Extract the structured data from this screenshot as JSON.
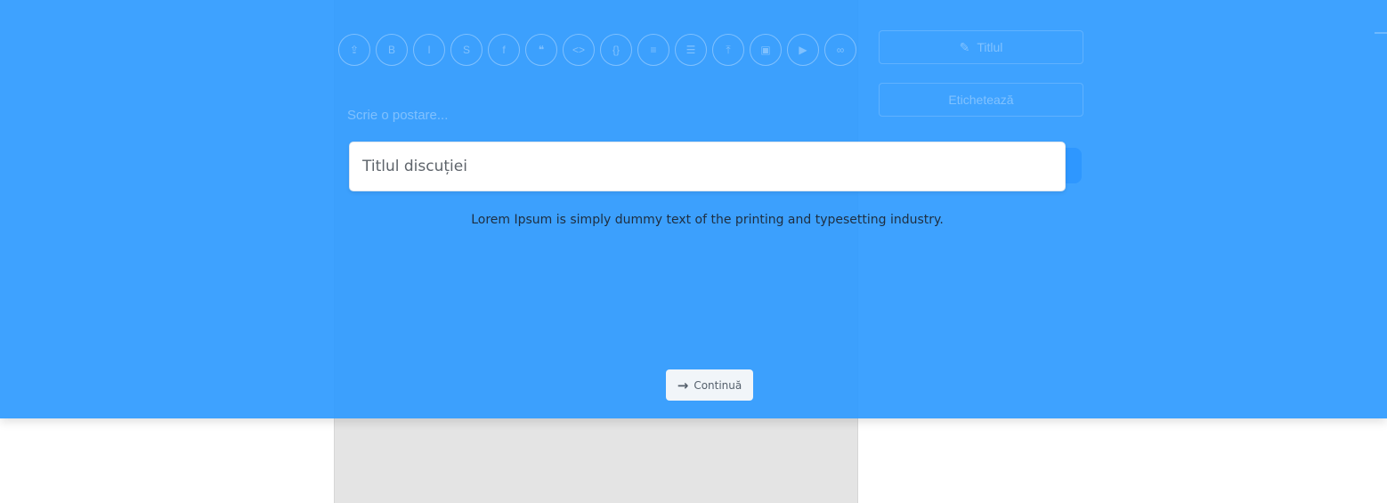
{
  "background": {
    "post_placeholder": "Scrie o postare...",
    "sidebar_title_label": "Titlul",
    "sidebar_tags_label": "Etichetează",
    "toolbar_icons": [
      "share-icon",
      "bold-icon",
      "italic-icon",
      "strikethrough-icon",
      "link-icon",
      "quote-icon",
      "code-icon",
      "code-block-icon",
      "list-icon",
      "numbered-list-icon",
      "image-upload-icon",
      "image-icon",
      "video-icon",
      "link-alt-icon"
    ]
  },
  "modal": {
    "title_placeholder": "Titlul discuției",
    "hint": "Lorem Ipsum is simply dummy text of the printing and typesetting industry.",
    "continue_label": "Continuă",
    "continue_icon": "arrow-right-icon"
  },
  "colors": {
    "overlay": "#2f9bff",
    "button_bg": "#f1f5f9"
  }
}
